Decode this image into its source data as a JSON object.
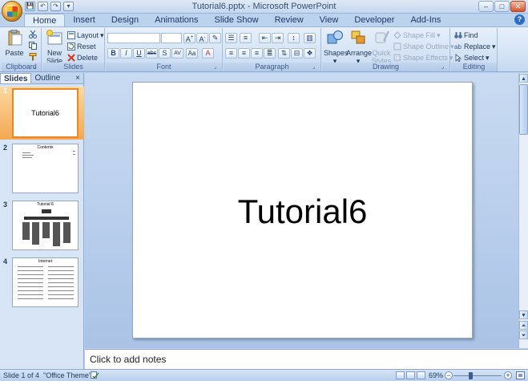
{
  "window": {
    "title": "Tutorial6.pptx - Microsoft PowerPoint",
    "minimize": "–",
    "maximize": "□",
    "close": "✕"
  },
  "qat": [
    "💾",
    "↶",
    "↷",
    "▾"
  ],
  "tabs": [
    "Home",
    "Insert",
    "Design",
    "Animations",
    "Slide Show",
    "Review",
    "View",
    "Developer",
    "Add-Ins"
  ],
  "active_tab": "Home",
  "help": "?",
  "ribbon": {
    "clipboard": {
      "label": "Clipboard",
      "paste": "Paste"
    },
    "slides": {
      "label": "Slides",
      "new_slide": "New Slide",
      "layout": "Layout",
      "reset": "Reset",
      "delete": "Delete"
    },
    "font": {
      "label": "Font",
      "buttons": [
        "B",
        "I",
        "U",
        "abc",
        "S",
        "AV",
        "Aa",
        "A"
      ]
    },
    "paragraph": {
      "label": "Paragraph"
    },
    "drawing": {
      "label": "Drawing",
      "shapes": "Shapes",
      "arrange": "Arrange",
      "quick_styles": "Quick Styles",
      "shape_fill": "Shape Fill",
      "shape_outline": "Shape Outline",
      "shape_effects": "Shape Effects"
    },
    "editing": {
      "label": "Editing",
      "find": "Find",
      "replace": "Replace",
      "select": "Select"
    }
  },
  "pane": {
    "tabs": [
      "Slides",
      "Outline"
    ],
    "active": "Slides",
    "close": "×"
  },
  "slides": [
    {
      "num": "1",
      "title": "Tutorial6",
      "selected": true
    },
    {
      "num": "2",
      "title": "Contents",
      "selected": false
    },
    {
      "num": "3",
      "title": "Tutorial 6",
      "selected": false
    },
    {
      "num": "4",
      "title": "Internet",
      "selected": false
    }
  ],
  "current_slide": {
    "title": "Tutorial6"
  },
  "notes": {
    "placeholder": "Click to add notes"
  },
  "status": {
    "slide_of": "Slide 1 of 4",
    "theme": "\"Office Theme\"",
    "zoom": "69%",
    "zoom_fraction": 0.69
  }
}
